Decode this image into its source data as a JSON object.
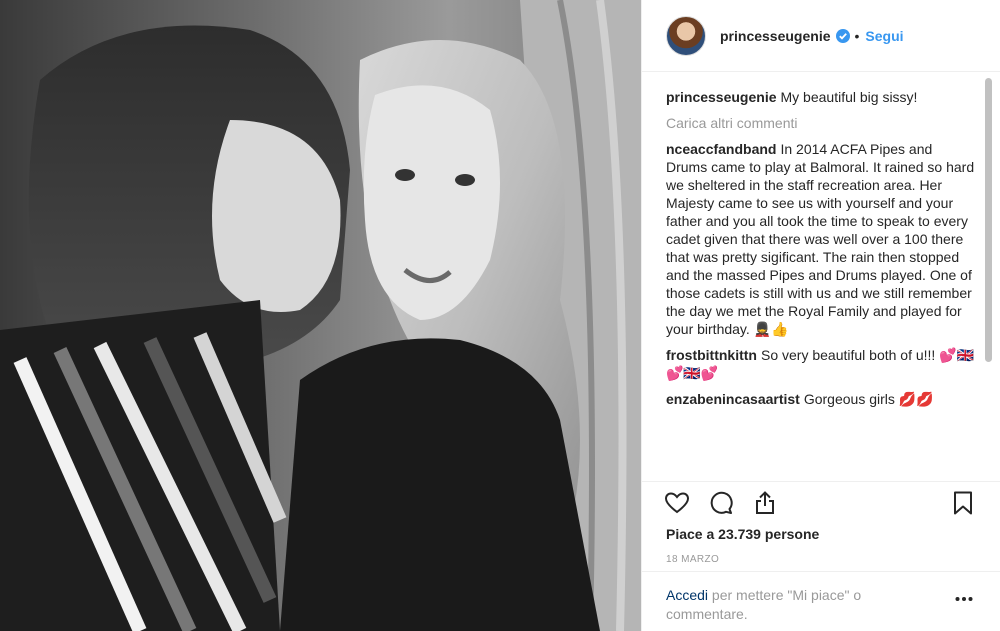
{
  "post": {
    "username": "princesseugenie",
    "follow_label": "Segui",
    "separator": "•"
  },
  "comments": [
    {
      "user": "princesseugenie",
      "text": "My beautiful big sissy!"
    },
    {
      "user": "nceacсfandband",
      "text": "In 2014 ACFA Pipes and Drums came to play at Balmoral. It rained so hard we sheltered in the staff recreation area. Her Majesty came to see us with yourself and your father and you all took the time to speak to every cadet given that there was well over a 100 there that was pretty sigificant. The rain then stopped and the massed Pipes and Drums played. One of those cadets is still with us and we still remember the day we met the Royal Family and played for your birthday. 💂👍"
    },
    {
      "user": "frostbittnkittn",
      "text": "So very beautiful both of u!!! 💕🇬🇧💕🇬🇧💕"
    },
    {
      "user": "enzabenincasaartist",
      "text": "Gorgeous girls 💋💋"
    }
  ],
  "load_more_label": "Carica altri commenti",
  "likes_text": "Piace a 23.739 persone",
  "date_text": "18 MARZO",
  "login": {
    "link_label": "Accedi",
    "rest_text": " per mettere \"Mi piace\" o commentare."
  },
  "icons": {
    "verified": "verified-badge-icon",
    "like": "heart-icon",
    "comment": "comment-bubble-icon",
    "share": "share-icon",
    "save": "bookmark-icon",
    "more": "more-options-icon"
  },
  "colors": {
    "accent": "#3897f0",
    "muted": "#999999",
    "text": "#262626",
    "link": "#003569"
  }
}
